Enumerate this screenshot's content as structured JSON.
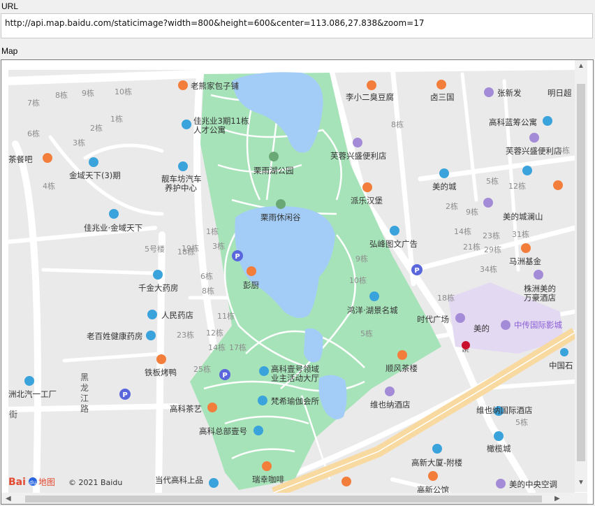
{
  "labels": {
    "url": "URL",
    "map": "Map"
  },
  "url_value": "http://api.map.baidu.com/staticimage?width=800&height=600&center=113.086,27.838&zoom=17",
  "colors": {
    "park": "#a7e3b9",
    "water": "#a3cdf6",
    "road": "#ffffff",
    "block": "#ebeaea",
    "highway": "#f8d9a0",
    "purple_zone": "#e3d9f2",
    "poi_orange": "#f37e3c",
    "poi_blue": "#3aa3dc",
    "poi_purple": "#a48bd7",
    "parking": "#5a67dc"
  },
  "map": {
    "logo_text": "Bai",
    "logo_text2": "du",
    "logo_map": "地图",
    "copyright": "© 2021 Baidu",
    "pois": [
      {
        "name": "老熊家包子铺",
        "icon": "restaurant-icon",
        "color": "orange"
      },
      {
        "name": "李小二臭豆腐",
        "icon": "restaurant-icon",
        "color": "orange"
      },
      {
        "name": "卤三国",
        "icon": "restaurant-icon",
        "color": "orange"
      },
      {
        "name": "张新发",
        "icon": "shop-icon",
        "color": "purple"
      },
      {
        "name": "明日超",
        "icon": "shop-icon",
        "color": "purple"
      },
      {
        "name": "佳兆业3期11栋人才公寓",
        "icon": "building-icon",
        "color": "blue"
      },
      {
        "name": "高科蓝筹公寓",
        "icon": "building-icon",
        "color": "blue"
      },
      {
        "name": "芙蓉兴盛便利店",
        "icon": "shop-icon",
        "color": "purple"
      },
      {
        "name": "芙蓉兴盛便利店",
        "icon": "shop-icon",
        "color": "purple"
      },
      {
        "name": "栗雨湖公园",
        "icon": "park-icon",
        "color": "green"
      },
      {
        "name": "茶餐吧",
        "icon": "restaurant-icon",
        "color": "orange"
      },
      {
        "name": "金域天下(3)期",
        "icon": "building-icon",
        "color": "blue"
      },
      {
        "name": "靓车坊汽车养护中心",
        "icon": "car-icon",
        "color": "blue"
      },
      {
        "name": "美的城",
        "icon": "building-icon",
        "color": "blue"
      },
      {
        "name": "派乐汉堡",
        "icon": "restaurant-icon",
        "color": "orange"
      },
      {
        "name": "栗雨休闲谷",
        "icon": "park-icon",
        "color": "green"
      },
      {
        "name": "佳兆业·金域天下",
        "icon": "building-icon",
        "color": "blue"
      },
      {
        "name": "美的城澜山",
        "icon": "shop-icon",
        "color": "purple"
      },
      {
        "name": "弘峰图文广告",
        "icon": "building-icon",
        "color": "blue"
      },
      {
        "name": "马洲基金",
        "icon": "star-icon",
        "color": "orange"
      },
      {
        "name": "千金大药房",
        "icon": "pharmacy-icon",
        "color": "blue"
      },
      {
        "name": "彭厨",
        "icon": "restaurant-icon",
        "color": "orange"
      },
      {
        "name": "株洲美的万豪酒店",
        "icon": "hotel-icon",
        "color": "purple"
      },
      {
        "name": "鸿洋·湖景名城",
        "icon": "building-icon",
        "color": "blue"
      },
      {
        "name": "人民药店",
        "icon": "pharmacy-icon",
        "color": "blue"
      },
      {
        "name": "时代广场",
        "icon": "shop-icon",
        "color": "purple"
      },
      {
        "name": "美的",
        "icon": "shop-icon",
        "color": "purple"
      },
      {
        "name": "中传国际影城",
        "icon": "cinema-icon",
        "color": "purple"
      },
      {
        "name": "老百姓健康药房",
        "icon": "pharmacy-icon",
        "color": "blue"
      },
      {
        "name": "铁板烤鸭",
        "icon": "restaurant-icon",
        "color": "orange"
      },
      {
        "name": "高科壹号领域业主活动大厅",
        "icon": "building-icon",
        "color": "blue"
      },
      {
        "name": "顺风茶楼",
        "icon": "restaurant-icon",
        "color": "orange"
      },
      {
        "name": "中国石",
        "icon": "building-icon",
        "color": "blue"
      },
      {
        "name": "洲北汽一工厂",
        "icon": "building-icon",
        "color": "blue"
      },
      {
        "name": "梵希瑜伽会所",
        "icon": "building-icon",
        "color": "blue"
      },
      {
        "name": "维也纳酒店",
        "icon": "hotel-icon",
        "color": "purple"
      },
      {
        "name": "高科茶艺",
        "icon": "restaurant-icon",
        "color": "orange"
      },
      {
        "name": "维也纳国际酒店",
        "icon": "building-icon",
        "color": "blue"
      },
      {
        "name": "高科总部壹号",
        "icon": "building-icon",
        "color": "blue"
      },
      {
        "name": "橄榄城",
        "icon": "building-icon",
        "color": "blue"
      },
      {
        "name": "高新大厦-附楼",
        "icon": "building-icon",
        "color": "blue"
      },
      {
        "name": "瑞幸咖啡",
        "icon": "restaurant-icon",
        "color": "orange"
      },
      {
        "name": "当代高科上品",
        "icon": "building-icon",
        "color": "blue"
      },
      {
        "name": "高新公馆",
        "icon": "restaurant-icon",
        "color": "orange"
      },
      {
        "name": "美的中央空调",
        "icon": "shop-icon",
        "color": "purple"
      }
    ],
    "block_labels": [
      "8栋",
      "9栋",
      "10栋",
      "7栋",
      "1栋",
      "2栋",
      "3栋",
      "6栋",
      "4栋",
      "8栋",
      "6栋",
      "5栋",
      "12栋",
      "2栋",
      "9栋",
      "14栋",
      "23栋",
      "31栋",
      "21栋",
      "29栋",
      "34栋",
      "18栋",
      "1栋",
      "3栋",
      "5号楼",
      "19栋",
      "6栋",
      "8栋",
      "9栋",
      "10栋",
      "18栋",
      "11栋",
      "12栋",
      "23栋",
      "14栋",
      "17栋",
      "5栋",
      "25栋",
      "5栋"
    ],
    "road_names": [
      "黑龙江路",
      "街"
    ],
    "kfc": "KFC"
  }
}
